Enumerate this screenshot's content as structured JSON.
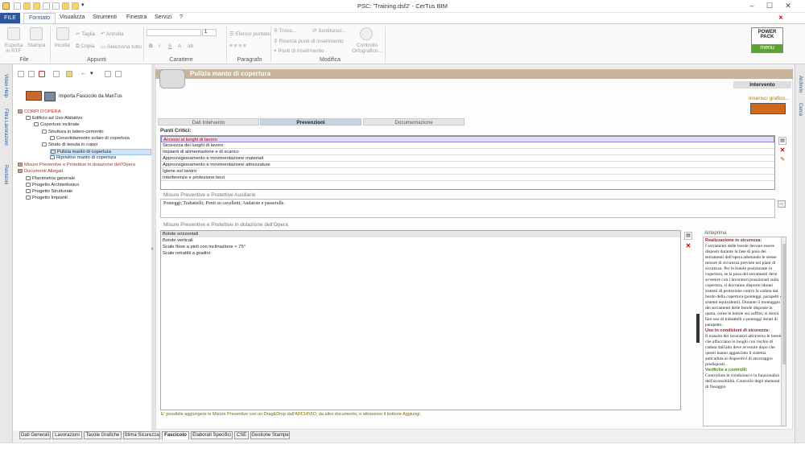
{
  "window": {
    "title": "PSC: 'Training.dsf2' - CerTus BIM"
  },
  "menu": {
    "file": "FILE",
    "tabs": [
      "Formato",
      "Visualizza",
      "Strumenti",
      "Finestra",
      "Servizi",
      "?"
    ]
  },
  "ribbon": {
    "groups": [
      "File",
      "Appunti",
      "Carattere",
      "Paragrafo",
      "Modifica"
    ],
    "file": {
      "export": "Esporta in RTF",
      "print": "Stampa"
    },
    "clipboard": {
      "paste": "Incolla",
      "cut": "Taglia",
      "copy": "Copia",
      "undo": "Annulla",
      "select_all": "Seleziona tutto"
    },
    "font": {
      "size": "1"
    },
    "paragraph": {
      "list": "Elenco puntato"
    },
    "edit": {
      "find": "Trova...",
      "replace": "Sostituisci...",
      "find_insert": "Ricerca punti di inserimento",
      "insert_points": "Punti di inserimento",
      "spellcheck": "Controllo Ortografico..."
    },
    "power_pack": {
      "line1": "POWER",
      "line2": "PACK",
      "menu": "menu"
    }
  },
  "left_strip": [
    "Video Help",
    "Filtra Lavorazioni",
    "Revisioni"
  ],
  "right_strip": [
    "Archivio",
    "Cerca"
  ],
  "tree": {
    "import": "Importa Fascicolo da ManTus",
    "items": [
      {
        "label": "CORPI D'OPERA",
        "level": 0,
        "color": "#b03020"
      },
      {
        "label": "Edificio ad Uso Abitativo",
        "level": 1
      },
      {
        "label": "Coperture inclinate",
        "level": 2
      },
      {
        "label": "Struttura in latero-cemento",
        "level": 3
      },
      {
        "label": "Consolidamento solaio di copertura",
        "level": 4
      },
      {
        "label": "Strato di tenuta in coppi",
        "level": 3
      },
      {
        "label": "Pulizia manto di copertura",
        "level": 4,
        "selected": true
      },
      {
        "label": "Ripristino manto di copertura",
        "level": 4
      },
      {
        "label": "Misure Preventive e Protettive in dotazione dell'Opera",
        "level": 0,
        "color": "#b03020"
      },
      {
        "label": "Documenti Allegati",
        "level": 0,
        "color": "#b03020"
      },
      {
        "label": "Planimetria generale",
        "level": 1
      },
      {
        "label": "Progetto Architettonico",
        "level": 1
      },
      {
        "label": "Progetto Strutturale",
        "level": 1
      },
      {
        "label": "Progetto Impianti",
        "level": 1
      }
    ]
  },
  "header": {
    "title": "Pulizia manto di copertura",
    "intervento": "Intervento",
    "insert_graphic": "Inserisci grafico..."
  },
  "tabs": [
    "Dati Intervento",
    "Prevenzioni",
    "Documentazione"
  ],
  "punti_critici": {
    "label": "Punti Critici:",
    "rows": [
      "Accessi ai luoghi di lavoro",
      "Sicurezza dei luoghi di lavoro",
      "Impianti di alimentazione e di scarico",
      "Approvvigionamento e movimentazione materiali",
      "Approvvigionamento e movimentazione attrezzature",
      "Igiene sul lavoro",
      "Interferenze e protezione terzi"
    ]
  },
  "ausiliarie": {
    "label": "Misure Preventive e Protettive Ausiliarie",
    "text": "Ponteggi; Trabattelli; Ponti su cavalletti; Andatoie e passerelle.",
    "more": "..."
  },
  "dotazione": {
    "label": "Misure Preventive e Protettive in dotazione dell'Opera",
    "rows": [
      "Botole orizzontali",
      "Botole verticali",
      "Scale fisse a pioli con inclinazione < 75°",
      "Scale retrattili a gradini"
    ],
    "hint": "E' possibile aggiungere le Misure Preventive con un Drag&Drop dall'ARCHIVIO, da altro documento, o attraverso il bottone Aggiungi."
  },
  "preview": {
    "label": "Anteprima",
    "h1": "Realizzazione in sicurezza:",
    "p1": "I serramenti delle botole devono essere disposti durante la fase di posa dei serramenti dell'opera adottando le stesse misure di sicurezza previste nei piani di sicurezza. Per le botole posizionate in copertura, se la posa dei serramenti deve avvenire con i lavoratori posizionati sulla copertura, si dovranno disporre idonei sistemi di protezione contro la caduta dal bordo della copertura (ponteggi, parapetti o sistemi equivalenti). Durante il montaggio dei serramenti delle botole disposte in quota, come le botole sui soffitti, si dovrà fare uso di trabattelli o ponteggi dotati di parapetto.",
    "h2": "Uso in condizioni di sicurezza:",
    "p2": "Il transito dei lavoratori attraverso le botole che affacciano in luoghi con rischio di caduta dall'alto deve avvenire dopo che questi hanno agganciato il sistema anticaduta ai dispositivi di ancoraggio predisposti.",
    "h3": "Verifiche e controlli:",
    "p3": "Controllare le condizioni e la funzionalità dell'accessibilità. Controllo degli elementi di fissaggio"
  },
  "bottom_tabs": [
    "Dati Generali",
    "Lavorazioni",
    "Tavole Grafiche",
    "Stima Sicurezza",
    "Fascicolo",
    "Elaborati Specifici",
    "CSE",
    "Gestione Stampe"
  ],
  "colors": {
    "accent": "#2b579a",
    "header_band": "#c7b49a",
    "power_green": "#5ca431"
  }
}
